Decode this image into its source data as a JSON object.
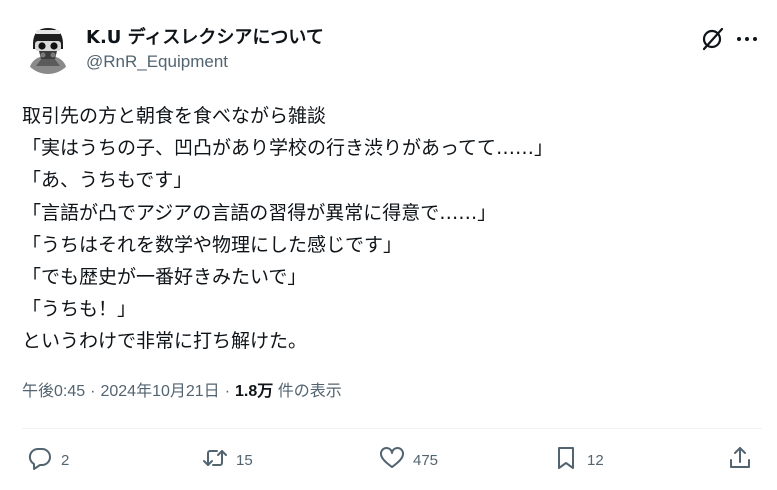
{
  "author": {
    "display_name": "K.U ディスレクシアについて",
    "handle": "@RnR_Equipment"
  },
  "body_lines": [
    "取引先の方と朝食を食べながら雑談",
    "「実はうちの子、凹凸があり学校の行き渋りがあってて……」",
    "「あ、うちもです」",
    "「言語が凸でアジアの言語の習得が異常に得意で……」",
    "「うちはそれを数学や物理にした感じです」",
    "「でも歴史が一番好きみたいで」",
    "「うちも！」",
    "というわけで非常に打ち解けた。"
  ],
  "meta": {
    "time": "午後0:45",
    "separator": "·",
    "date": "2024年10月21日",
    "views_count": "1.8万",
    "views_label": "件の表示"
  },
  "actions": {
    "reply_count": "2",
    "retweet_count": "15",
    "like_count": "475",
    "bookmark_count": "12"
  },
  "icons": {
    "header": [
      "grok-icon",
      "more-icon"
    ],
    "actions": [
      "reply-icon",
      "retweet-icon",
      "like-icon",
      "bookmark-icon",
      "share-icon"
    ]
  },
  "colors": {
    "text": "#0f1419",
    "secondary": "#536471",
    "divider": "#eff3f4",
    "background": "#ffffff"
  }
}
